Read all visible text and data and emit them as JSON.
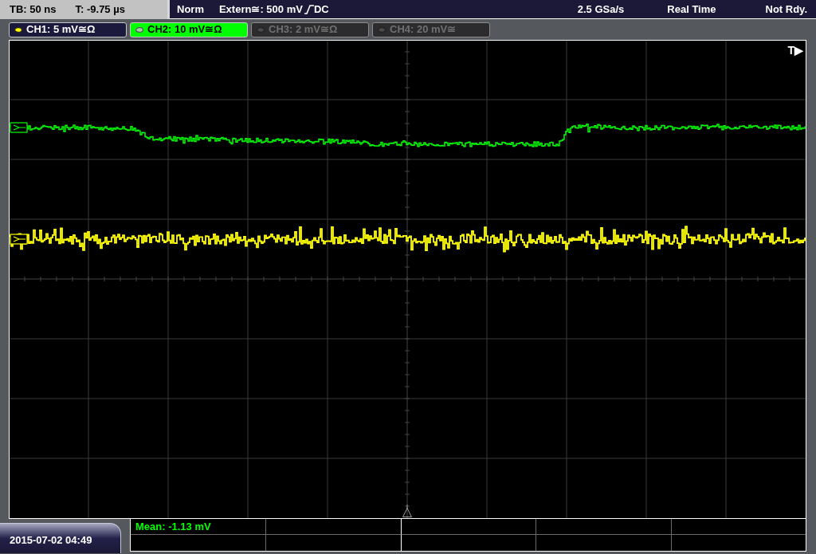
{
  "status_bar": {
    "timebase": "TB: 50 ns",
    "trigger_offset": "T: -9.75 µs",
    "trigger_mode": "Norm",
    "trigger_source": "Extern≅: 500 mV",
    "rising_edge": true,
    "trigger_coupling": "DC",
    "sample_rate": "2.5 GSa/s",
    "acquisition_mode": "Real Time",
    "status": "Not Rdy."
  },
  "channels": [
    {
      "label": "CH1: 5 mV≅Ω",
      "color": "#ffff00",
      "enabled": true,
      "selected": false
    },
    {
      "label": "CH2: 10 mV≅Ω",
      "color": "#00ff00",
      "enabled": true,
      "selected": true
    },
    {
      "label": "CH3: 2 mV≅Ω",
      "enabled": false,
      "selected": false
    },
    {
      "label": "CH4: 20 mV≅",
      "enabled": false,
      "selected": false
    }
  ],
  "display": {
    "trigger_marker": "T▶"
  },
  "measurements": [
    {
      "text": "Mean: -1.13 mV"
    }
  ],
  "date_time": "2015-07-02 04:49"
}
